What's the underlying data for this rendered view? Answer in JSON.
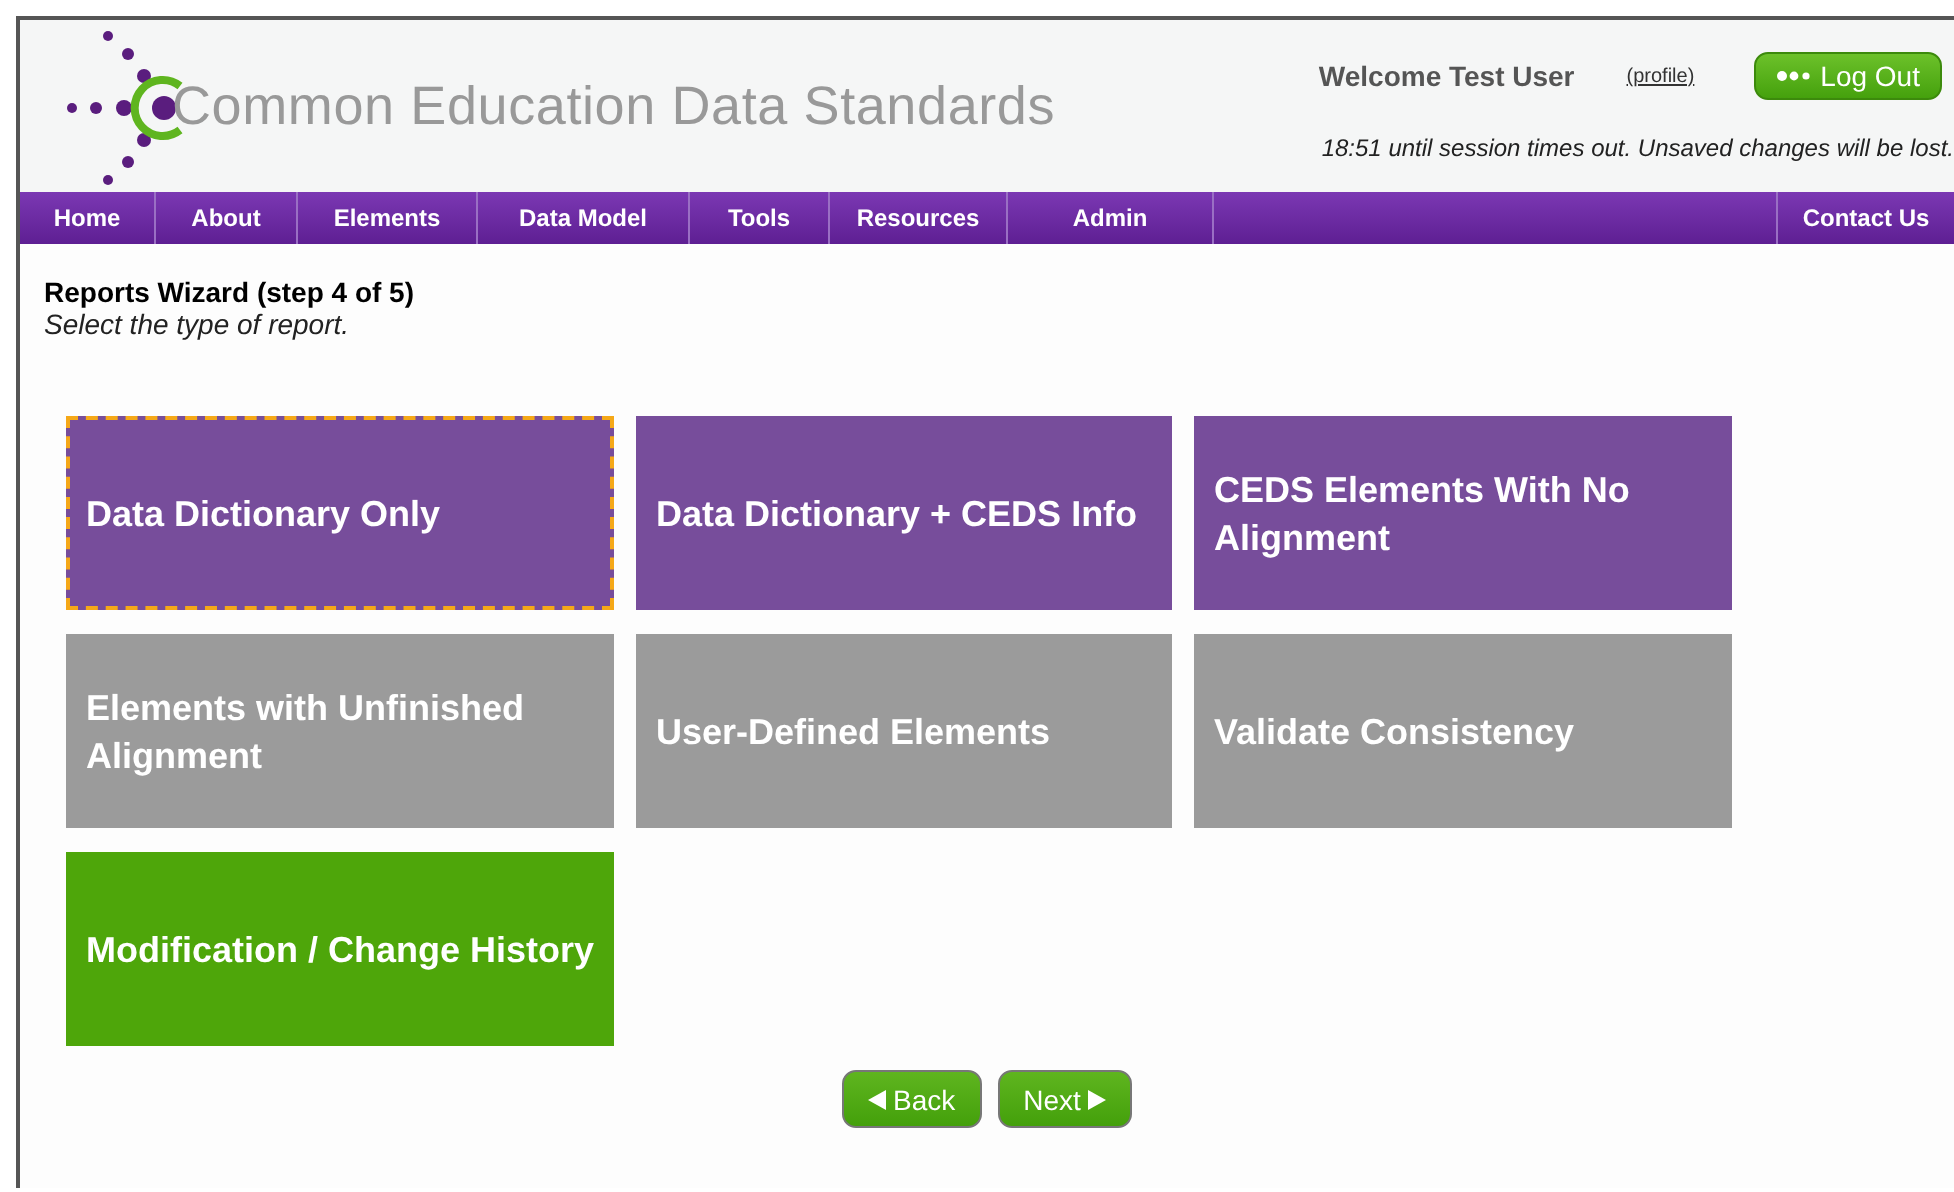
{
  "header": {
    "logo_text": "Common Education Data Standards",
    "welcome": "Welcome Test User",
    "profile_link": "(profile)",
    "logout_button": "Log Out",
    "session_notice": "18:51 until session times out. Unsaved changes will be lost."
  },
  "nav": [
    {
      "label": "Home"
    },
    {
      "label": "About"
    },
    {
      "label": "Elements"
    },
    {
      "label": "Data Model"
    },
    {
      "label": "Tools"
    },
    {
      "label": "Resources"
    },
    {
      "label": "Admin"
    },
    {
      "label": "Contact Us"
    }
  ],
  "wizard": {
    "title": "Reports Wizard (step 4 of 5)",
    "subtitle": "Select the type of report."
  },
  "report_types": [
    {
      "label": "Data Dictionary Only",
      "color": "#774d9b",
      "selected": true
    },
    {
      "label": "Data Dictionary + CEDS Info",
      "color": "#774d9b",
      "selected": false
    },
    {
      "label": "CEDS Elements With No Alignment",
      "color": "#774d9b",
      "selected": false
    },
    {
      "label": "Elements with Unfinished Alignment",
      "color": "#9b9b9b",
      "selected": false
    },
    {
      "label": "User-Defined Elements",
      "color": "#9b9b9b",
      "selected": false
    },
    {
      "label": "Validate Consistency",
      "color": "#9b9b9b",
      "selected": false
    },
    {
      "label": "Modification / Change History",
      "color": "#4ea60a",
      "selected": false
    }
  ],
  "buttons": [
    {
      "label": "Back",
      "kind": "back"
    },
    {
      "label": "Next",
      "kind": "next"
    }
  ]
}
